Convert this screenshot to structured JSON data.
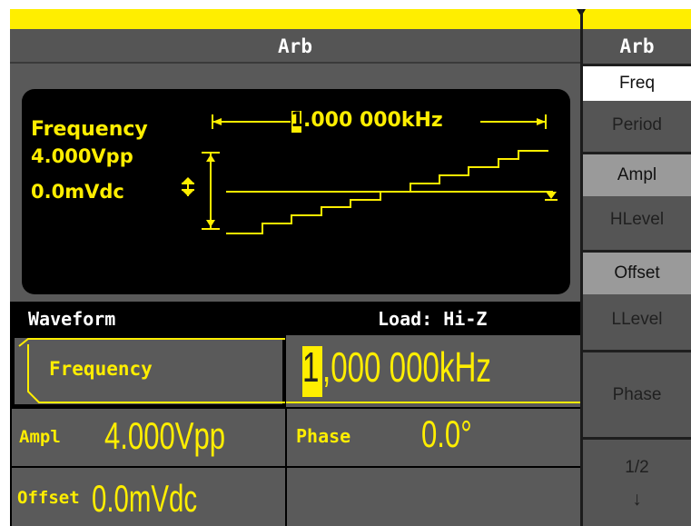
{
  "title": "Arb",
  "graph": {
    "param_name": "Frequency",
    "amplitude": "4.000Vpp",
    "offset": "0.0mVdc",
    "freq_cursor_digit": "1",
    "freq_rest": ".000 000kHz"
  },
  "status": {
    "left": "Waveform",
    "right": "Load: Hi-Z"
  },
  "params": {
    "frequency_label": "Frequency",
    "frequency_cursor_digit": "1",
    "frequency_rest": ",000 000kHz",
    "ampl_label": "Ampl",
    "ampl_value": "4.000Vpp",
    "phase_label": "Phase",
    "phase_value": "0.0°",
    "offset_label": "Offset",
    "offset_value": "0.0mVdc"
  },
  "softkeys": {
    "title": "Arb",
    "freq": "Freq",
    "period": "Period",
    "ampl": "Ampl",
    "hlevel": "HLevel",
    "offset": "Offset",
    "llevel": "LLevel",
    "phase": "Phase",
    "page": "1/2",
    "next_arrow": "↓"
  },
  "colors": {
    "accent": "#ffee00",
    "panel": "#595959",
    "selected_softkey": "#ffffff"
  }
}
